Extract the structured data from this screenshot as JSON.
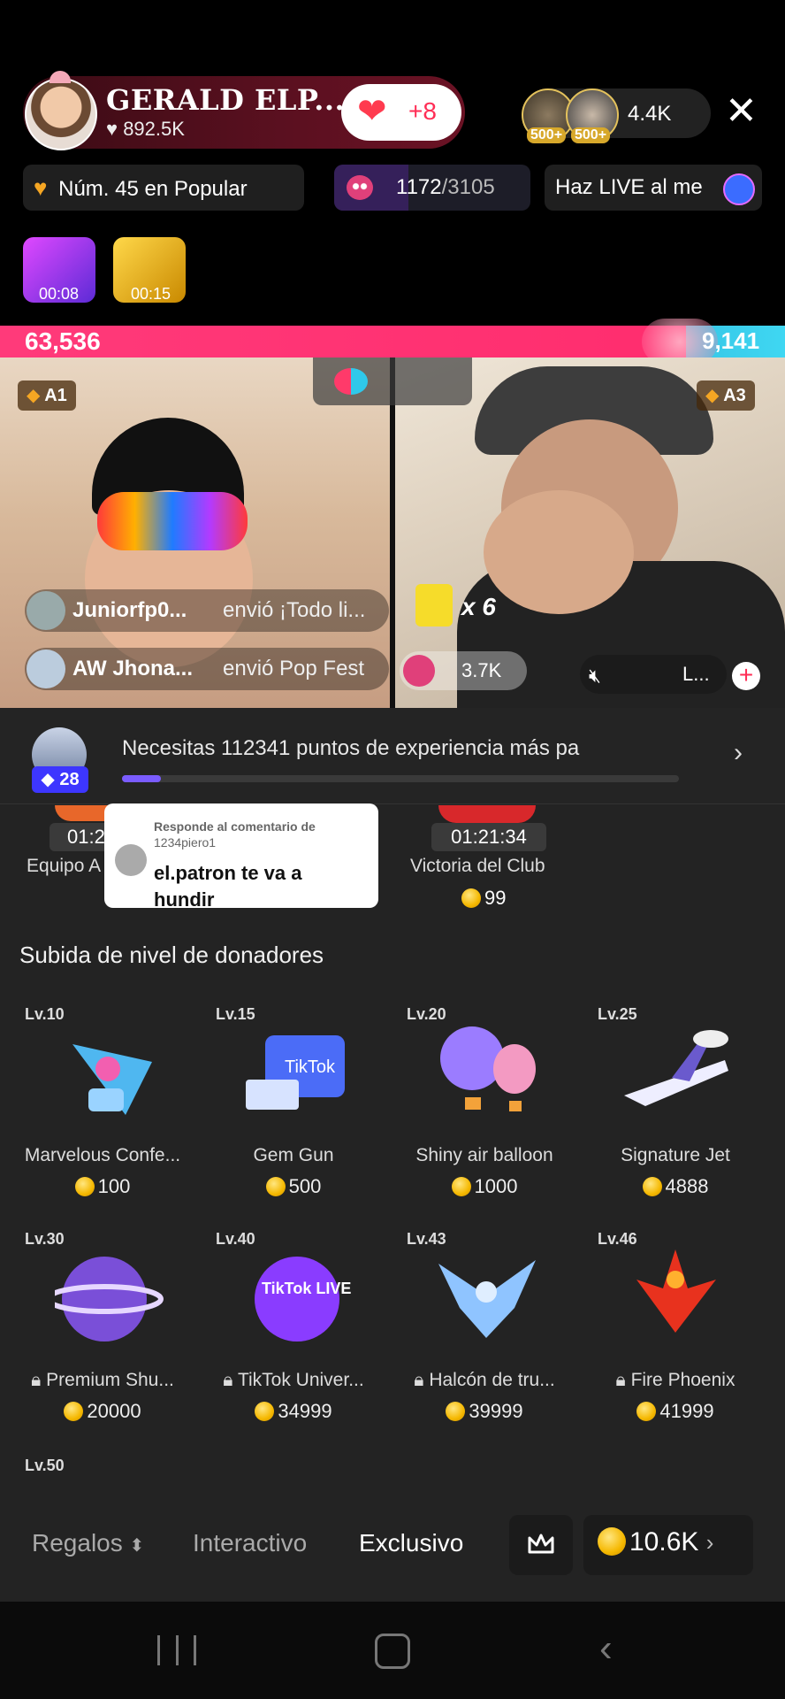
{
  "header": {
    "host_name": "GERALD ELP...",
    "host_likes": "892.5K",
    "like_plus": "+8",
    "viewer_badge_1": "500+",
    "viewer_badge_2": "500+",
    "viewer_count": "4.4K"
  },
  "chips": {
    "popular": "Núm. 45 en Popular",
    "progress_value": "1172",
    "progress_total": "/3105",
    "progress_fraction": 0.377,
    "live_banner": "Haz LIVE al me"
  },
  "timers": [
    "00:08",
    "00:15"
  ],
  "battle": {
    "score_left": "63,536",
    "score_right": "9,141",
    "left_share": 0.874,
    "badge_left": "A1",
    "badge_right": "A3"
  },
  "comments": [
    {
      "user": "Juniorfp0...",
      "text": "envió ¡Todo li...",
      "multiplier": "x 6"
    },
    {
      "user": "AW Jhona...",
      "text": "envió Pop Fest",
      "count": "3.7K"
    }
  ],
  "right_overlay": {
    "label": "L..."
  },
  "xp": {
    "level": "28",
    "text": "Necesitas 112341 puntos de experiencia más pa",
    "fraction": 0.07
  },
  "prev_row": [
    {
      "timer": "01:2",
      "name": "Equipo A",
      "price": ""
    },
    {
      "timer": "01:21:34",
      "name": "Victoria del Club",
      "price": "99"
    }
  ],
  "tooltip": {
    "reply_to": "Responde al comentario de",
    "user": "1234piero1",
    "text": "el.patron te va a hundir"
  },
  "section_title": "Subida de nivel de donadores",
  "gifts_row1": [
    {
      "level": "Lv.10",
      "name": "Marvelous Confe...",
      "price": "100",
      "locked": false
    },
    {
      "level": "Lv.15",
      "name": "Gem Gun",
      "price": "500",
      "locked": false
    },
    {
      "level": "Lv.20",
      "name": "Shiny air balloon",
      "price": "1000",
      "locked": false
    },
    {
      "level": "Lv.25",
      "name": "Signature Jet",
      "price": "4888",
      "locked": false
    }
  ],
  "gifts_row2": [
    {
      "level": "Lv.30",
      "name": "Premium Shu...",
      "price": "20000",
      "locked": true
    },
    {
      "level": "Lv.40",
      "name": "TikTok Univer...",
      "price": "34999",
      "locked": true
    },
    {
      "level": "Lv.43",
      "name": "Halcón de tru...",
      "price": "39999",
      "locked": true
    },
    {
      "level": "Lv.46",
      "name": "Fire Phoenix",
      "price": "41999",
      "locked": true
    }
  ],
  "next_level": "Lv.50",
  "tabs": {
    "gifts": "Regalos",
    "interactive": "Interactivo",
    "exclusive": "Exclusivo",
    "balance": "10.6K"
  },
  "gem_gun_art_text": "TikTok",
  "tiktok_live_art_text": "TikTok LIVE",
  "colors": {
    "accent_pink": "#ff2d6e",
    "accent_blue": "#3fd7f2",
    "gold": "#f5b800"
  }
}
